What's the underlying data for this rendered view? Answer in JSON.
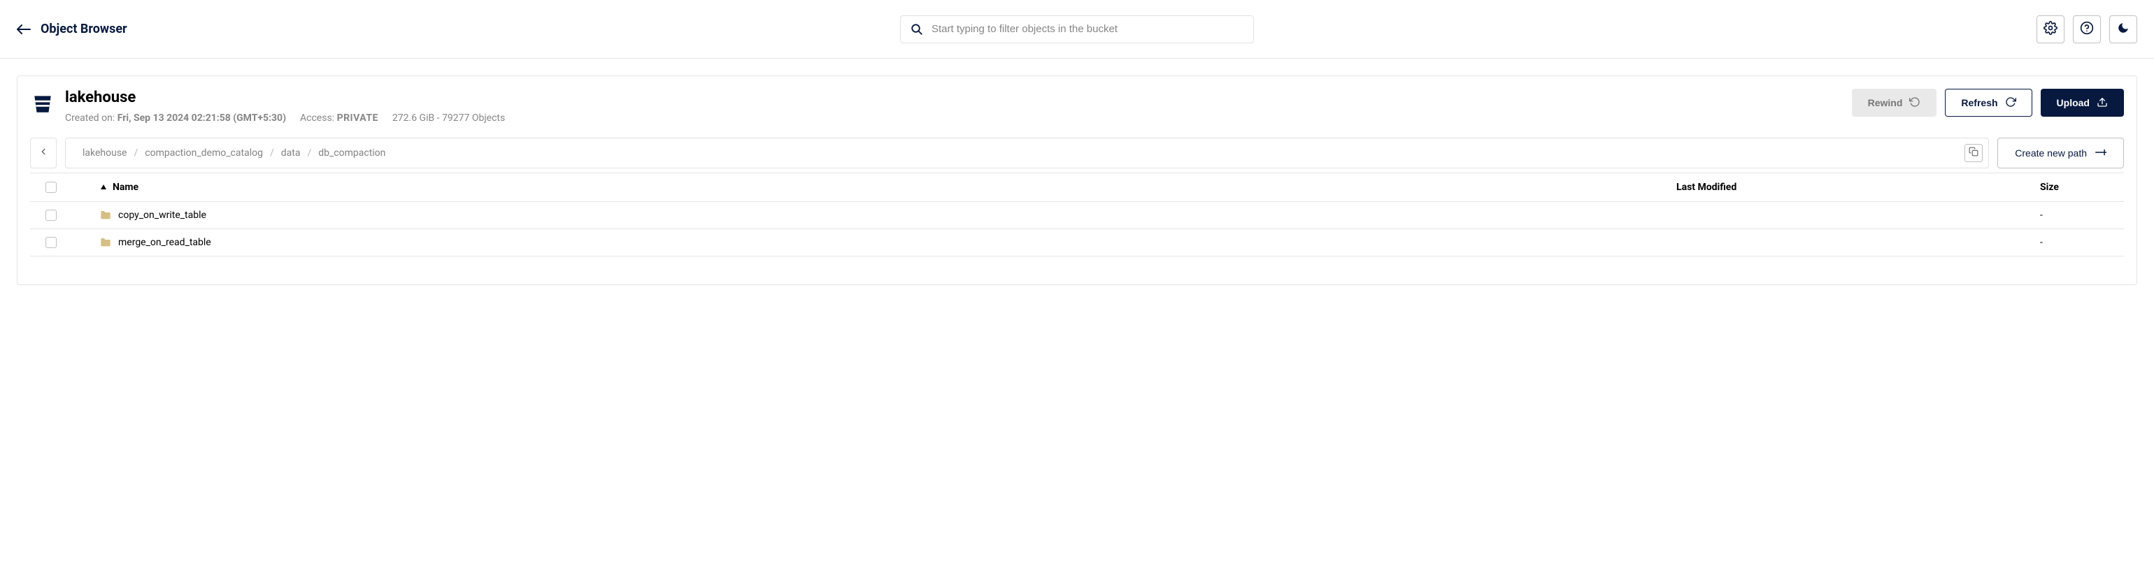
{
  "header": {
    "title": "Object Browser",
    "search_placeholder": "Start typing to filter objects in the bucket"
  },
  "bucket": {
    "name": "lakehouse",
    "created_label": "Created on:",
    "created_value": "Fri, Sep 13 2024 02:21:58 (GMT+5:30)",
    "access_label": "Access:",
    "access_value": "PRIVATE",
    "stats": "272.6 GiB - 79277 Objects"
  },
  "actions": {
    "rewind": "Rewind",
    "refresh": "Refresh",
    "upload": "Upload",
    "create_path": "Create new path"
  },
  "breadcrumbs": [
    "lakehouse",
    "compaction_demo_catalog",
    "data",
    "db_compaction"
  ],
  "columns": {
    "name": "Name",
    "last_modified": "Last Modified",
    "size": "Size"
  },
  "rows": [
    {
      "name": "copy_on_write_table",
      "last_modified": "",
      "size": "-"
    },
    {
      "name": "merge_on_read_table",
      "last_modified": "",
      "size": "-"
    }
  ]
}
